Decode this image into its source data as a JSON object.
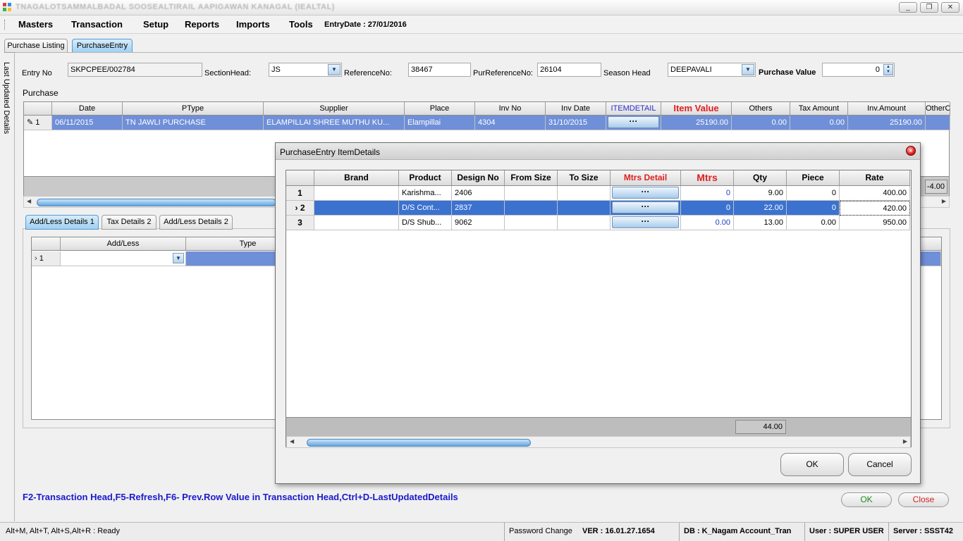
{
  "window": {
    "title": "TNAGALOTSAMMALBADAL SOOSEALTIRAIL AAPIGAWAN KANAGAL (IEALTAL)",
    "buttons": [
      "_",
      "❐",
      "✕"
    ]
  },
  "menu": {
    "items": [
      "Masters",
      "Transaction",
      "Setup",
      "Reports",
      "Imports",
      "Tools"
    ],
    "entry_date": "EntryDate : 27/01/2016"
  },
  "tabs": [
    "Purchase Listing",
    "PurchaseEntry"
  ],
  "side_tab": "Last Updated Details",
  "form": {
    "entry_no_label": "Entry No",
    "entry_no": "SKPCPEE/002784",
    "section_head_label": "SectionHead:",
    "section_head": "JS",
    "reference_no_label": "ReferenceNo:",
    "reference_no": "38467",
    "pur_reference_no_label": "PurReferenceNo:",
    "pur_reference_no": "26104",
    "season_head_label": "Season Head",
    "season_head": "DEEPAVALI",
    "purchase_value_label": "Purchase Value",
    "purchase_value": "0",
    "purchase_label": "Purchase"
  },
  "purchase_grid": {
    "columns": [
      "",
      "Date",
      "PType",
      "Supplier",
      "Place",
      "Inv No",
      "Inv Date",
      "ITEMDETAIL",
      "Item Value",
      "Others",
      "Tax Amount",
      "Inv.Amount",
      "OtherC"
    ],
    "row": {
      "num": "1",
      "date": "06/11/2015",
      "ptype": "TN JAWLI PURCHASE",
      "supplier": "ELAMPILLAI SHREE MUTHU KU...",
      "place": "Elampillai",
      "inv_no": "4304",
      "inv_date": "31/10/2015",
      "item_detail": "···",
      "item_value": "25190.00",
      "others": "0.00",
      "tax_amount": "0.00",
      "inv_amount": "25190.00"
    },
    "footer_value": "-4.00"
  },
  "bottom_tabs": [
    "Add/Less Details 1",
    "Tax Details 2",
    "Add/Less Details 2"
  ],
  "addless_grid": {
    "columns": [
      "",
      "Add/Less",
      "Type"
    ],
    "row_num": "1"
  },
  "shortcut_text": "F2-Transaction Head,F5-Refresh,F6- Prev.Row Value in Transaction Head,Ctrl+D-LastUpdatedDetails",
  "main_buttons": {
    "ok": "OK",
    "close": "Close"
  },
  "status": {
    "left": "Alt+M, Alt+T, Alt+S,Alt+R  : Ready",
    "password_change": "Password Change",
    "version": "VER : 16.01.27.1654",
    "db": "DB : K_Nagam Account_Tran",
    "user": "User : SUPER USER",
    "server": "Server : SSST42"
  },
  "modal": {
    "title": "PurchaseEntry ItemDetails",
    "columns": [
      "",
      "Brand",
      "Product",
      "Design No",
      "From Size",
      "To Size",
      "Mtrs Detail",
      "Mtrs",
      "Qty",
      "Piece",
      "Rate"
    ],
    "rows": [
      {
        "num": "1",
        "brand": "",
        "product": "Karishma...",
        "design_no": "2406",
        "from_size": "",
        "to_size": "",
        "mtrs_detail": "···",
        "mtrs": "0",
        "qty": "9.00",
        "piece": "0",
        "rate": "400.00"
      },
      {
        "num": "2",
        "brand": "",
        "product": "D/S Cont...",
        "design_no": "2837",
        "from_size": "",
        "to_size": "",
        "mtrs_detail": "···",
        "mtrs": "0",
        "qty": "22.00",
        "piece": "0",
        "rate": "420.00"
      },
      {
        "num": "3",
        "brand": "",
        "product": "D/S Shub...",
        "design_no": "9062",
        "from_size": "",
        "to_size": "",
        "mtrs_detail": "···",
        "mtrs": "0.00",
        "qty": "13.00",
        "piece": "0.00",
        "rate": "950.00"
      }
    ],
    "total_qty": "44.00",
    "ok": "OK",
    "cancel": "Cancel"
  },
  "colors": {
    "accent_blue": "#1a1acd",
    "header_red": "#e02020",
    "selected_row": "#3b72d0",
    "close_red": "#d22222",
    "ok_green": "#1a8a1a"
  }
}
